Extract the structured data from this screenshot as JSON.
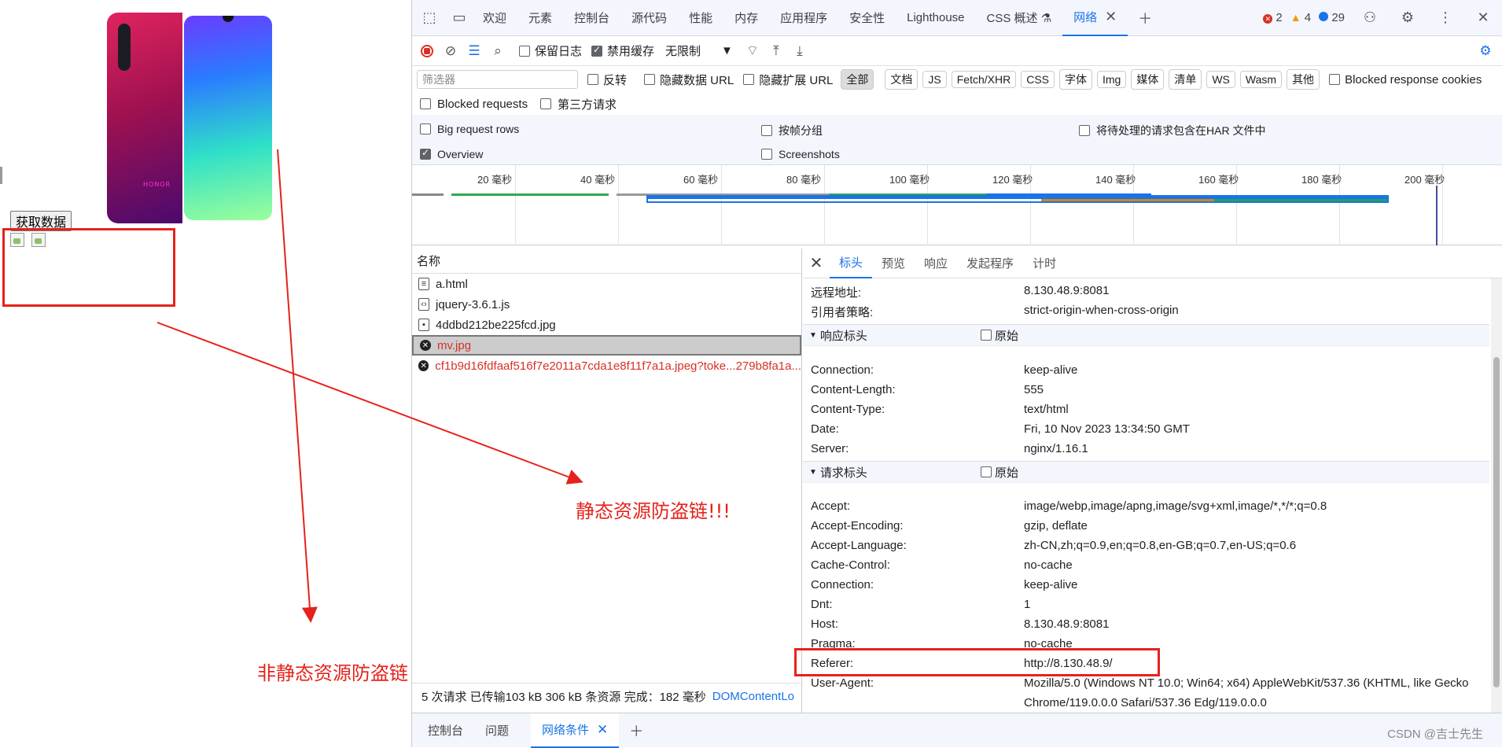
{
  "page": {
    "fetch_button": "获取数据",
    "label_static": "静态资源防盗链!!!",
    "label_nonstatic": "非静态资源防盗链",
    "phone_brand": "HONOR"
  },
  "devtools": {
    "tabs": [
      "欢迎",
      "元素",
      "控制台",
      "源代码",
      "性能",
      "内存",
      "应用程序",
      "安全性",
      "Lighthouse",
      "CSS 概述 ⚗",
      "网络"
    ],
    "errors": "2",
    "warnings": "4",
    "messages": "29",
    "toolbar": {
      "preserve_log": "保留日志",
      "disable_cache": "禁用缓存",
      "throttle": "无限制"
    },
    "filter": {
      "placeholder": "筛选器",
      "invert": "反转",
      "hide_data_urls": "隐藏数据 URL",
      "hide_ext_urls": "隐藏扩展 URL",
      "types": [
        "全部",
        "文档",
        "JS",
        "Fetch/XHR",
        "CSS",
        "字体",
        "Img",
        "媒体",
        "清单",
        "WS",
        "Wasm",
        "其他"
      ],
      "blocked_cookies": "Blocked response cookies",
      "blocked_requests": "Blocked requests",
      "third_party": "第三方请求"
    },
    "settings": {
      "big_rows": "Big request rows",
      "group_by_frame": "按帧分组",
      "har_pending": "将待处理的请求包含在HAR 文件中",
      "overview": "Overview",
      "screenshots": "Screenshots"
    },
    "timeline_labels": [
      "20 毫秒",
      "40 毫秒",
      "60 毫秒",
      "80 毫秒",
      "100 毫秒",
      "120 毫秒",
      "140 毫秒",
      "160 毫秒",
      "180 毫秒",
      "200 毫秒"
    ],
    "name_header": "名称",
    "requests": [
      {
        "name": "a.html",
        "icon": "doc"
      },
      {
        "name": "jquery-3.6.1.js",
        "icon": "script"
      },
      {
        "name": "4ddbd212be225fcd.jpg",
        "icon": "image"
      },
      {
        "name": "mv.jpg",
        "icon": "error"
      },
      {
        "name": "cf1b9d16fdfaaf516f7e2011a7cda1e8f11f7a1a.jpeg?toke...279b8fa1a...",
        "icon": "error"
      }
    ],
    "detail_tabs": [
      "标头",
      "预览",
      "响应",
      "发起程序",
      "计时"
    ],
    "general": [
      {
        "k": "远程地址:",
        "v": "8.130.48.9:8081"
      },
      {
        "k": "引用者策略:",
        "v": "strict-origin-when-cross-origin"
      }
    ],
    "response_headers_title": "响应标头",
    "raw_label": "原始",
    "response_headers": [
      {
        "k": "Connection:",
        "v": "keep-alive"
      },
      {
        "k": "Content-Length:",
        "v": "555"
      },
      {
        "k": "Content-Type:",
        "v": "text/html"
      },
      {
        "k": "Date:",
        "v": "Fri, 10 Nov 2023 13:34:50 GMT"
      },
      {
        "k": "Server:",
        "v": "nginx/1.16.1"
      }
    ],
    "request_headers_title": "请求标头",
    "request_headers": [
      {
        "k": "Accept:",
        "v": "image/webp,image/apng,image/svg+xml,image/*,*/*;q=0.8"
      },
      {
        "k": "Accept-Encoding:",
        "v": "gzip, deflate"
      },
      {
        "k": "Accept-Language:",
        "v": "zh-CN,zh;q=0.9,en;q=0.8,en-GB;q=0.7,en-US;q=0.6"
      },
      {
        "k": "Cache-Control:",
        "v": "no-cache"
      },
      {
        "k": "Connection:",
        "v": "keep-alive"
      },
      {
        "k": "Dnt:",
        "v": "1"
      },
      {
        "k": "Host:",
        "v": "8.130.48.9:8081"
      },
      {
        "k": "Pragma:",
        "v": "no-cache"
      },
      {
        "k": "Referer:",
        "v": "http://8.130.48.9/"
      },
      {
        "k": "User-Agent:",
        "v": "Mozilla/5.0 (Windows NT 10.0; Win64; x64) AppleWebKit/537.36 (KHTML, like Gecko"
      },
      {
        "k": "",
        "v": "Chrome/119.0.0.0 Safari/537.36 Edg/119.0.0.0"
      }
    ],
    "status": {
      "summary": "5 次请求  已传输103 kB  306 kB 条资源  完成：182 毫秒",
      "link": "DOMContentLo"
    },
    "drawer_tabs": [
      "控制台",
      "问题",
      "网络条件"
    ],
    "watermark": "CSDN @吉士先生"
  }
}
